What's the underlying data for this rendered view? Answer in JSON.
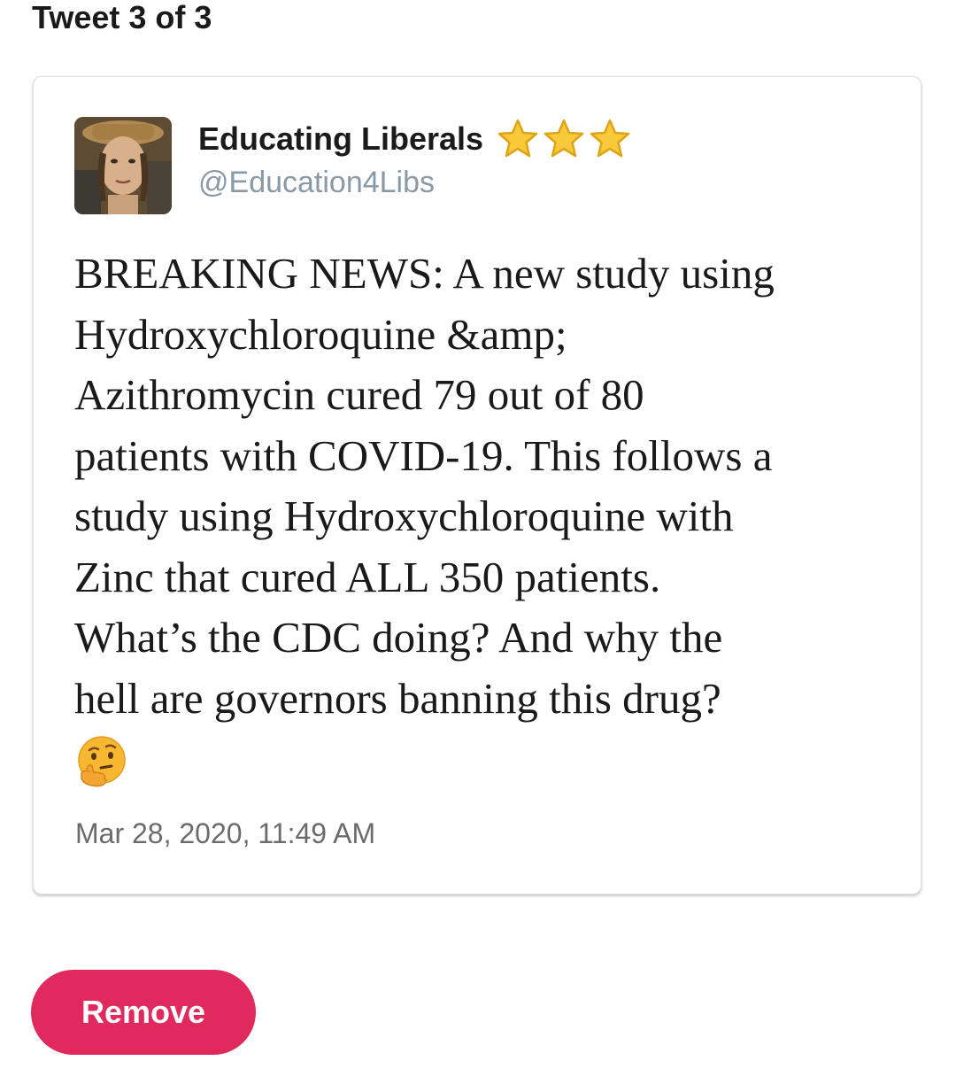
{
  "header": {
    "title": "Tweet 3 of 3"
  },
  "tweet": {
    "author_name": "Educating Liberals",
    "author_badges": [
      "star-icon",
      "star-icon",
      "star-icon"
    ],
    "handle": "@Education4Libs",
    "text": "BREAKING NEWS: A new study using\nHydroxychloroquine &amp;\nAzithromycin cured 79 out of 80\npatients with COVID-19. This follows a\nstudy using Hydroxychloroquine with\nZinc that cured ALL 350 patients.\nWhat’s the CDC doing? And why the\nhell are governors banning this drug?",
    "emoji": "thinking-face-icon",
    "timestamp": "Mar 28, 2020, 11:49 AM"
  },
  "actions": {
    "remove_label": "Remove"
  },
  "colors": {
    "remove_button": "#e0295c",
    "handle": "#8a99a6",
    "timestamp": "#6b6b6b",
    "star_fill": "#f8c93a",
    "star_stroke": "#e0a316"
  }
}
